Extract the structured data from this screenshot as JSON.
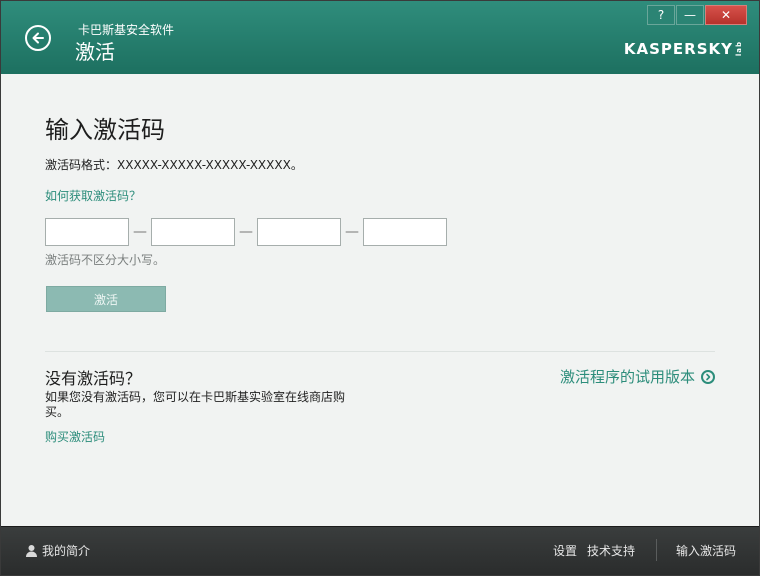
{
  "header": {
    "app_name": "卡巴斯基安全软件",
    "page_title": "激活",
    "brand": "KASPERSKY",
    "brand_sub": "lab",
    "controls": {
      "help": "?",
      "minimize": "—",
      "close": "✕"
    }
  },
  "main": {
    "title": "输入激活码",
    "format_text": "激活码格式：XXXXX-XXXXX-XXXXX-XXXXX。",
    "howto_link": "如何获取激活码？",
    "code_fields": [
      {
        "value": "",
        "placeholder": ""
      },
      {
        "value": "",
        "placeholder": ""
      },
      {
        "value": "",
        "placeholder": ""
      },
      {
        "value": "",
        "placeholder": ""
      }
    ],
    "dash": "—",
    "case_note": "激活码不区分大小写。",
    "activate_button": "激活",
    "no_code_title": "没有激活码？",
    "no_code_desc": "如果您没有激活码，您可以在卡巴斯基实验室在线商店购买。",
    "buy_link": "购买激活码",
    "trial_link": "激活程序的试用版本"
  },
  "footer": {
    "profile": "我的简介",
    "settings": "设置",
    "support": "技术支持",
    "enter_code": "输入激活码"
  },
  "colors": {
    "header": "#22786a",
    "link": "#2c8d7b",
    "button_disabled": "#8cbab2",
    "footer": "#2f3232"
  },
  "icons": {
    "back": "arrow-left-circle-icon",
    "trial": "chevron-right-circle-icon",
    "profile": "user-icon"
  }
}
